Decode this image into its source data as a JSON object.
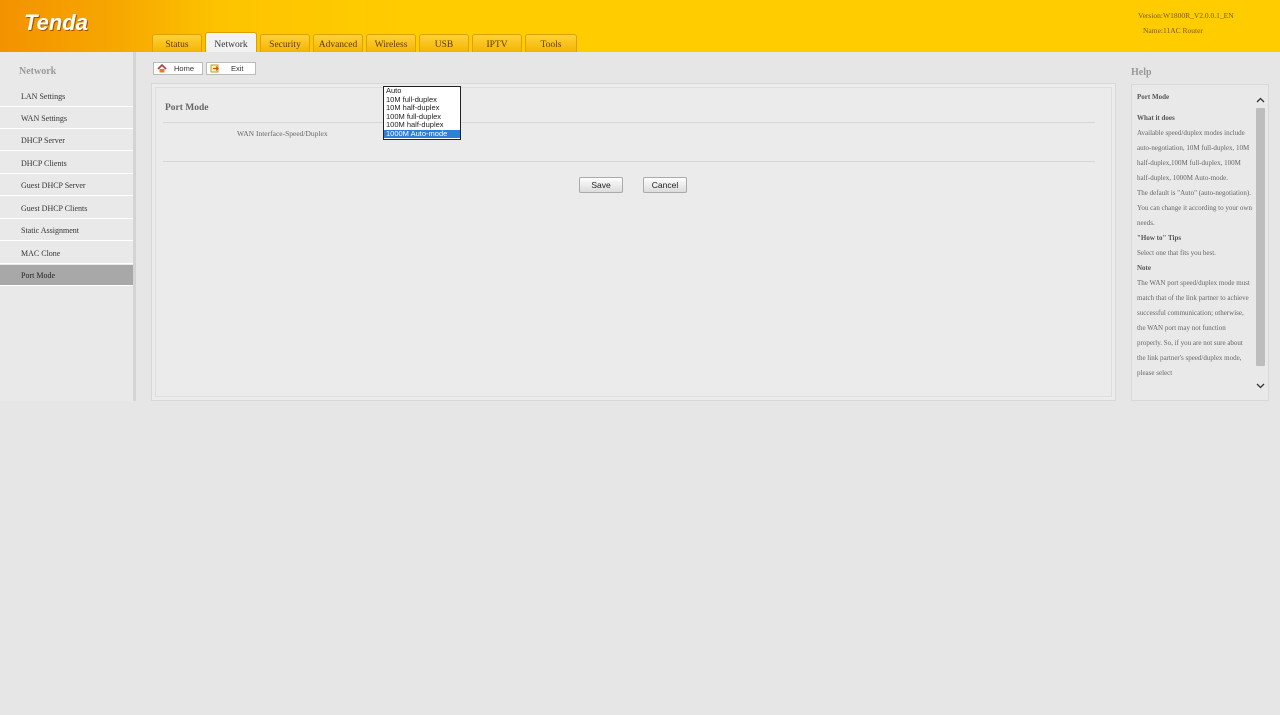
{
  "header": {
    "logo": "Tenda",
    "version": "Version:W1800R_V2.0.0.1_EN",
    "name": "Name:11AC Router",
    "tabs": [
      {
        "label": "Status"
      },
      {
        "label": "Network"
      },
      {
        "label": "Security"
      },
      {
        "label": "Advanced"
      },
      {
        "label": "Wireless"
      },
      {
        "label": "USB"
      },
      {
        "label": "IPTV"
      },
      {
        "label": "Tools"
      }
    ],
    "active_tab": "Network"
  },
  "sidebar": {
    "title": "Network",
    "items": [
      {
        "label": "LAN Settings"
      },
      {
        "label": "WAN Settings"
      },
      {
        "label": "DHCP Server"
      },
      {
        "label": "DHCP Clients"
      },
      {
        "label": "Guest DHCP Server"
      },
      {
        "label": "Guest DHCP Clients"
      },
      {
        "label": "Static Assignment"
      },
      {
        "label": "MAC Clone"
      },
      {
        "label": "Port Mode"
      }
    ],
    "active_item": "Port Mode"
  },
  "toolbar": {
    "home_label": "Home",
    "home_icon": "home-icon",
    "exit_label": "Exit",
    "exit_icon": "exit-icon"
  },
  "main": {
    "section_title": "Port Mode",
    "field_label": "WAN Interface-Speed/Duplex",
    "options": [
      {
        "label": "Auto"
      },
      {
        "label": "10M full-duplex"
      },
      {
        "label": "10M half-duplex"
      },
      {
        "label": "100M full-duplex"
      },
      {
        "label": "100M half-duplex"
      },
      {
        "label": "1000M Auto-mode"
      }
    ],
    "selected_option": "1000M Auto-mode",
    "save_label": "Save",
    "cancel_label": "Cancel"
  },
  "help": {
    "title": "Help",
    "heading": "Port Mode",
    "what_it_does_heading": "What it does",
    "what_it_does_text": "Available speed/duplex modes include auto-negotiation, 10M full-duplex, 10M half-duplex,100M full-duplex, 100M half-duplex, 1000M Auto-mode.",
    "default_text": "The default is \"Auto\" (auto-negotiation). You can change it according to your own needs.",
    "how_to_heading": "\"How to\" Tips",
    "how_to_text": "Select one that fits you best.",
    "note_heading": "Note",
    "note_text": "The WAN port speed/duplex mode must match that of the link partner to achieve successful communication; otherwise, the WAN port may not function properly. So, if you are not sure about the link partner's speed/duplex mode, please select"
  },
  "colors": {
    "header_yellow": "#ffcc00",
    "header_orange": "#f39200",
    "selection_blue": "#2f7fd8",
    "active_nav_gray": "#a8a8a8"
  }
}
